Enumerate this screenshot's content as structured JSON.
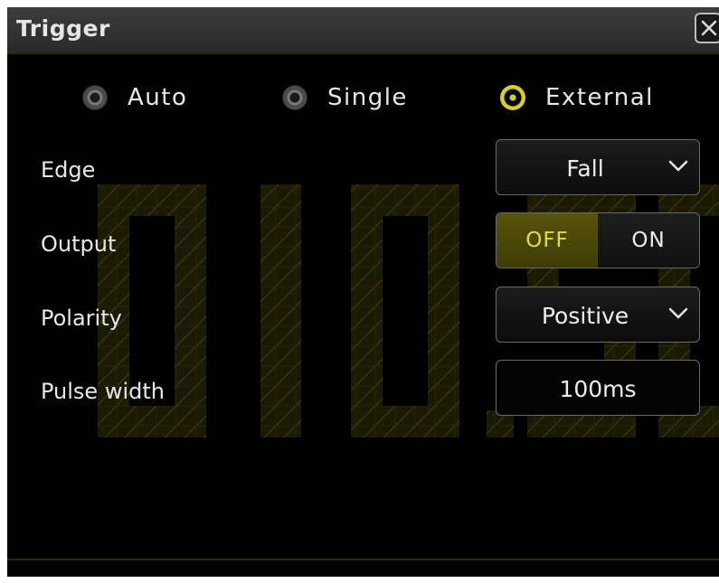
{
  "dialog": {
    "title": "Trigger",
    "close_icon": "close-icon"
  },
  "background": {
    "digits": "010.50"
  },
  "trigger_mode": {
    "options": [
      {
        "label": "Auto",
        "selected": false
      },
      {
        "label": "Single",
        "selected": false
      },
      {
        "label": "External",
        "selected": true
      }
    ]
  },
  "settings": {
    "edge": {
      "label": "Edge",
      "value": "Fall",
      "icon": "chevron-down-icon"
    },
    "output": {
      "label": "Output",
      "off_label": "OFF",
      "on_label": "ON",
      "value": "OFF"
    },
    "polarity": {
      "label": "Polarity",
      "value": "Positive",
      "icon": "chevron-down-icon"
    },
    "pulse_width": {
      "label": "Pulse width",
      "value": "100ms"
    }
  },
  "colors": {
    "accent": "#d7d02a",
    "toggle_active_bg": "#4c4a08",
    "background": "#000000",
    "titlebar": "#333333"
  }
}
